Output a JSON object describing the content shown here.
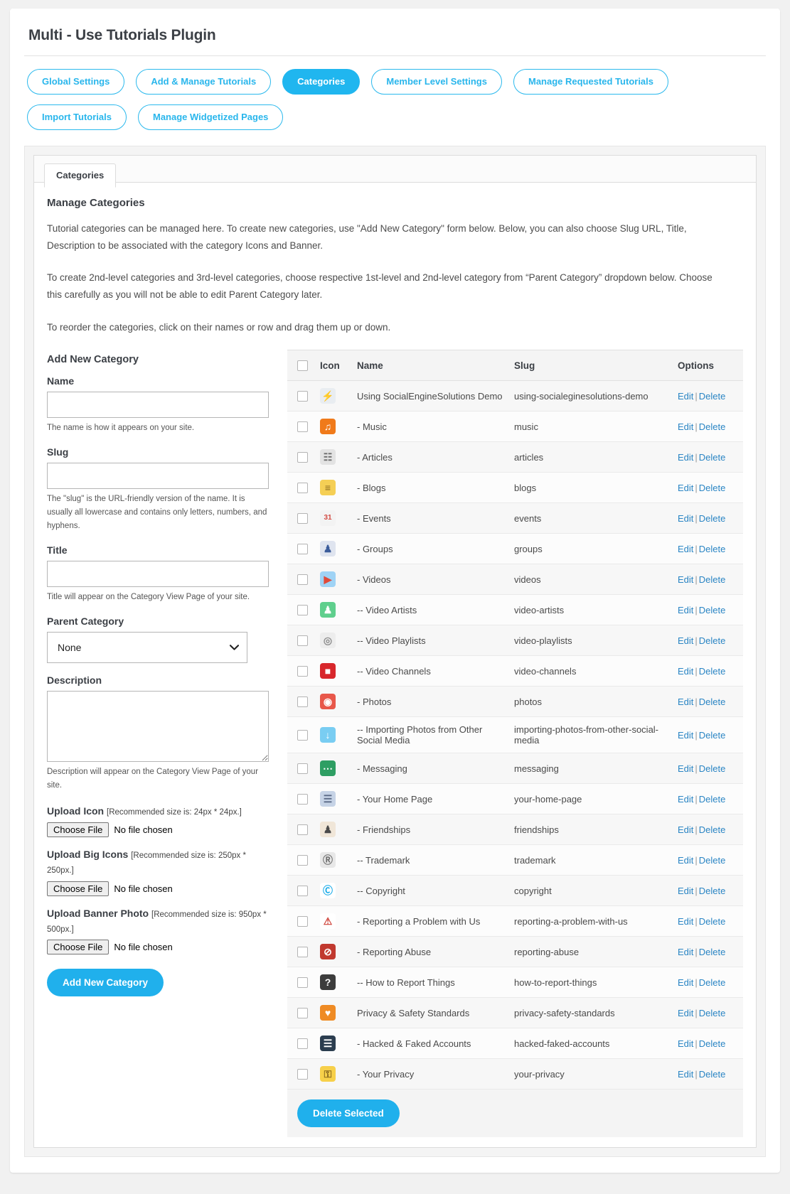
{
  "header": {
    "title": "Multi - Use Tutorials Plugin"
  },
  "nav": {
    "items": [
      {
        "label": "Global Settings",
        "active": false
      },
      {
        "label": "Add & Manage Tutorials",
        "active": false
      },
      {
        "label": "Categories",
        "active": true
      },
      {
        "label": "Member Level Settings",
        "active": false
      },
      {
        "label": "Manage Requested Tutorials",
        "active": false
      },
      {
        "label": "Import Tutorials",
        "active": false
      },
      {
        "label": "Manage Widgetized Pages",
        "active": false
      }
    ]
  },
  "panel": {
    "tab_label": "Categories",
    "section_title": "Manage Categories",
    "intro_1": "Tutorial categories can be managed here. To create new categories, use \"Add New Category\" form below. Below, you can also choose Slug URL, Title, Description to be associated with the category Icons and Banner.",
    "intro_2": "To create 2nd-level categories and 3rd-level categories, choose respective 1st-level and 2nd-level category from “Parent Category” dropdown below. Choose this carefully as you will not be able to edit Parent Category later.",
    "intro_3": "To reorder the categories, click on their names or row and drag them up or down."
  },
  "form": {
    "heading": "Add New Category",
    "name_label": "Name",
    "name_value": "",
    "name_hint": "The name is how it appears on your site.",
    "slug_label": "Slug",
    "slug_value": "",
    "slug_hint": "The \"slug\" is the URL-friendly version of the name. It is usually all lowercase and contains only letters, numbers, and hyphens.",
    "title_label": "Title",
    "title_value": "",
    "title_hint": "Title will appear on the Category View Page of your site.",
    "parent_label": "Parent Category",
    "parent_selected": "None",
    "parent_options": [
      "None"
    ],
    "description_label": "Description",
    "description_value": "",
    "description_hint": "Description will appear on the Category View Page of your site.",
    "upload_icon_label": "Upload Icon",
    "upload_icon_rec": "[Recommended size is: 24px * 24px.]",
    "upload_big_label": "Upload Big Icons",
    "upload_big_rec": "[Recommended size is: 250px * 250px.]",
    "upload_banner_label": "Upload Banner Photo",
    "upload_banner_rec": "[Recommended size is: 950px * 500px.]",
    "choose_file_label": "Choose File",
    "no_file_text": "No file chosen",
    "submit_label": "Add New Category"
  },
  "table": {
    "columns": {
      "icon": "Icon",
      "name": "Name",
      "slug": "Slug",
      "options": "Options"
    },
    "edit_label": "Edit",
    "delete_label": "Delete",
    "separator": "|",
    "delete_selected_label": "Delete Selected",
    "rows": [
      {
        "icon": "socialengine-icon",
        "glyph": "⚡",
        "color": "#7d8490",
        "bg": "#e9edf1",
        "name": "Using SocialEngineSolutions Demo",
        "slug": "using-socialeginesolutions-demo"
      },
      {
        "icon": "music-note-icon",
        "glyph": "♫",
        "color": "#ffffff",
        "bg": "#f07a1a",
        "name": "- Music",
        "slug": "music"
      },
      {
        "icon": "newspaper-icon",
        "glyph": "☷",
        "color": "#6d6d6d",
        "bg": "#e3e3e3",
        "name": "- Articles",
        "slug": "articles"
      },
      {
        "icon": "blog-post-icon",
        "glyph": "≡",
        "color": "#8a6a1f",
        "bg": "#f5cf55",
        "name": "- Blogs",
        "slug": "blogs"
      },
      {
        "icon": "calendar-icon",
        "glyph": "31",
        "color": "#d24a43",
        "bg": "#f3f3f3",
        "name": "- Events",
        "slug": "events"
      },
      {
        "icon": "group-people-icon",
        "glyph": "♟",
        "color": "#3b5c9b",
        "bg": "#dfe4ef",
        "name": "- Groups",
        "slug": "groups"
      },
      {
        "icon": "film-strip-icon",
        "glyph": "▶",
        "color": "#e04a3a",
        "bg": "#9fd3f5",
        "name": "- Videos",
        "slug": "videos"
      },
      {
        "icon": "video-artist-icon",
        "glyph": "♟",
        "color": "#ffffff",
        "bg": "#5fcf8d",
        "name": "-- Video Artists",
        "slug": "video-artists"
      },
      {
        "icon": "video-playlist-icon",
        "glyph": "◎",
        "color": "#8e8e8e",
        "bg": "#ededed",
        "name": "-- Video Playlists",
        "slug": "video-playlists"
      },
      {
        "icon": "video-channel-icon",
        "glyph": "■",
        "color": "#ffffff",
        "bg": "#d8272c",
        "name": "-- Video Channels",
        "slug": "video-channels"
      },
      {
        "icon": "camera-icon",
        "glyph": "◉",
        "color": "#ffffff",
        "bg": "#e8574a",
        "name": "- Photos",
        "slug": "photos"
      },
      {
        "icon": "download-arrow-icon",
        "glyph": "↓",
        "color": "#ffffff",
        "bg": "#79cdf2",
        "name": "-- Importing Photos from Other Social Media",
        "slug": "importing-photos-from-other-social-media"
      },
      {
        "icon": "chat-bubble-icon",
        "glyph": "⋯",
        "color": "#ffffff",
        "bg": "#2e9e63",
        "name": "- Messaging",
        "slug": "messaging"
      },
      {
        "icon": "homepage-icon",
        "glyph": "☰",
        "color": "#5b6b87",
        "bg": "#c6d3e6",
        "name": "- Your Home Page",
        "slug": "your-home-page"
      },
      {
        "icon": "friendship-icon",
        "glyph": "♟",
        "color": "#4a4a4a",
        "bg": "#f0e6d8",
        "name": "- Friendships",
        "slug": "friendships"
      },
      {
        "icon": "trademark-doc-icon",
        "glyph": "Ⓡ",
        "color": "#6d6d6d",
        "bg": "#e8e8e8",
        "name": "-- Trademark",
        "slug": "trademark"
      },
      {
        "icon": "copyright-icon",
        "glyph": "Ⓒ",
        "color": "#13a9e8",
        "bg": "#ffffff",
        "name": "-- Copyright",
        "slug": "copyright"
      },
      {
        "icon": "warning-triangle-icon",
        "glyph": "⚠",
        "color": "#d0473e",
        "bg": "#ffffff",
        "name": "- Reporting a Problem with Us",
        "slug": "reporting-a-problem-with-us"
      },
      {
        "icon": "prohibited-icon",
        "glyph": "⊘",
        "color": "#ffffff",
        "bg": "#c1392f",
        "name": "- Reporting Abuse",
        "slug": "reporting-abuse"
      },
      {
        "icon": "question-alert-icon",
        "glyph": "?",
        "color": "#ffffff",
        "bg": "#3c3c3c",
        "name": "-- How to Report Things",
        "slug": "how-to-report-things"
      },
      {
        "icon": "shield-icon",
        "glyph": "♥",
        "color": "#ffffff",
        "bg": "#ef8b24",
        "name": "Privacy & Safety Standards",
        "slug": "privacy-safety-standards"
      },
      {
        "icon": "hacked-account-icon",
        "glyph": "☰",
        "color": "#ffffff",
        "bg": "#2b3d4f",
        "name": "- Hacked & Faked Accounts",
        "slug": "hacked-faked-accounts"
      },
      {
        "icon": "lock-privacy-icon",
        "glyph": "⚿",
        "color": "#8a6a1f",
        "bg": "#f7d04a",
        "name": "- Your Privacy",
        "slug": "your-privacy"
      }
    ]
  }
}
